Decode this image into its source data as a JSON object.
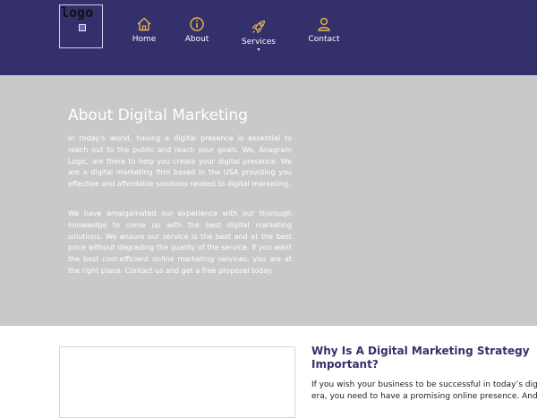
{
  "header": {
    "logo_text": "logo",
    "nav": [
      {
        "label": "Home",
        "icon": "home-icon"
      },
      {
        "label": "About",
        "icon": "info-icon"
      },
      {
        "label": "Services",
        "icon": "rocket-icon",
        "has_dropdown": true,
        "caret": "▾"
      },
      {
        "label": "Contact",
        "icon": "contact-person-icon"
      }
    ]
  },
  "hero": {
    "title": "About Digital Marketing",
    "paragraph1": "In today's world, having a digital presence is essential to reach out to the public and reach your goals. We, Anagram Logic, are there to help you create your digital presence. We are a digital marketing firm based in the USA providing you effective and affordable solutions related to digital marketing.",
    "paragraph2": "We have amalgamated our experience with our thorough knowledge to come up with the best digital marketing solutions. We ensure our service is the best and at the best price without degrading the quality of the service. If you want the best cost-efficient online marketing services, you are at the right place. Contact us and get a free proposal today."
  },
  "section": {
    "title": "Why Is A Digital Marketing Strategy Important?",
    "line1": "If you wish your business to be successful in today’s digit",
    "line2": "era, you need to have a promising online presence. And"
  },
  "colors": {
    "header_bg": "#34306b",
    "hero_bg": "#c9c9c9",
    "icon_accent": "#e8b84a"
  }
}
